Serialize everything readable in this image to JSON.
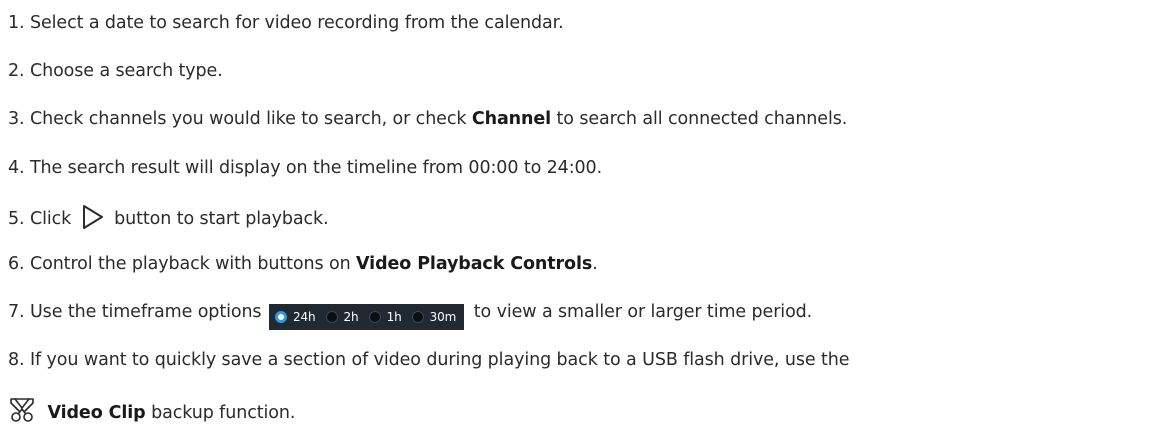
{
  "steps": [
    {
      "number": "1.",
      "text": "Select a date to search for video recording from the calendar."
    },
    {
      "number": "2.",
      "text": "Choose a search type."
    },
    {
      "number": "3.",
      "pre": "Check channels you would like to search, or check",
      "bold": "Channel",
      "post": "to search all connected channels."
    },
    {
      "number": "4.",
      "text": "The search result will display on the timeline from 00:00 to 24:00."
    },
    {
      "number": "5.",
      "pre": "Click",
      "post": "button to start playback."
    },
    {
      "number": "6.",
      "pre": "Control the playback with buttons on",
      "bold": "Video Playback Controls",
      "post": "."
    },
    {
      "number": "7.",
      "pre": "Use the timeframe options",
      "post": "to view a smaller or larger time period."
    },
    {
      "number": "8.",
      "text": "If you want to quickly save a section of video during playing back to a USB flash drive, use the"
    },
    {
      "bold": "Video Clip",
      "post": "backup function."
    }
  ],
  "timeframe": {
    "options": [
      "24h",
      "2h",
      "1h",
      "30m"
    ],
    "selected": "24h"
  },
  "icons": {
    "play": "play-outline-icon",
    "clip": "scissors-icon"
  },
  "colors": {
    "text": "#2b2b2b",
    "toolbar_bg": "#1f2a33",
    "radio_selected": "#2f9be0"
  }
}
